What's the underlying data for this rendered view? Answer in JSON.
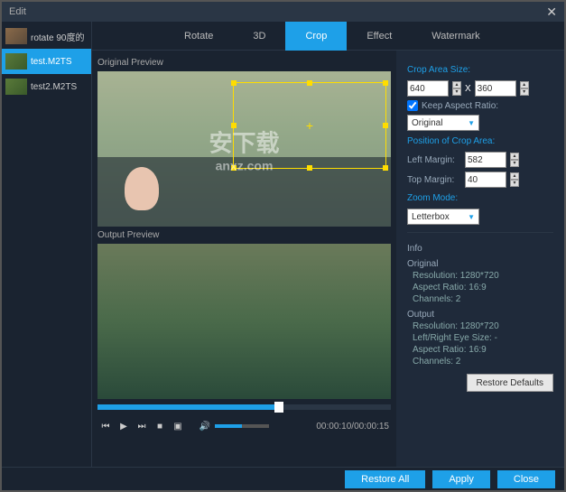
{
  "window": {
    "title": "Edit"
  },
  "sidebar": {
    "clips": [
      {
        "name": "rotate 90度的"
      },
      {
        "name": "test.M2TS"
      },
      {
        "name": "test2.M2TS"
      }
    ]
  },
  "tabs": [
    "Rotate",
    "3D",
    "Crop",
    "Effect",
    "Watermark"
  ],
  "preview": {
    "original_label": "Original Preview",
    "output_label": "Output Preview",
    "time": "00:00:10/00:00:15"
  },
  "settings": {
    "crop_size": {
      "title": "Crop Area Size:",
      "width": "640",
      "height": "360",
      "keep_aspect_label": "Keep Aspect Ratio:",
      "aspect_value": "Original"
    },
    "position": {
      "title": "Position of Crop Area:",
      "left_label": "Left Margin:",
      "left": "582",
      "top_label": "Top Margin:",
      "top": "40"
    },
    "zoom": {
      "title": "Zoom Mode:",
      "value": "Letterbox"
    },
    "info": {
      "title": "Info",
      "original": {
        "title": "Original",
        "resolution": "Resolution: 1280*720",
        "aspect": "Aspect Ratio: 16:9",
        "channels": "Channels: 2"
      },
      "output": {
        "title": "Output",
        "resolution": "Resolution: 1280*720",
        "eye": "Left/Right Eye Size: -",
        "aspect": "Aspect Ratio: 16:9",
        "channels": "Channels: 2"
      }
    },
    "restore_defaults": "Restore Defaults"
  },
  "footer": {
    "restore_all": "Restore All",
    "apply": "Apply",
    "close": "Close"
  }
}
